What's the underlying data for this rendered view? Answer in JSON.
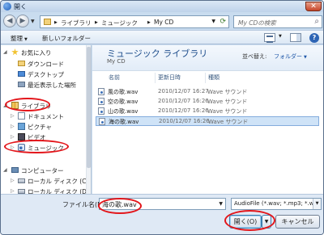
{
  "window": {
    "title": "開く",
    "close_label": "✕"
  },
  "nav": {
    "back_label": "◀",
    "forward_label": "▶",
    "breadcrumb": [
      "ライブラリ",
      "ミュージック",
      "My CD"
    ],
    "separator": "▶",
    "search_placeholder": "My CDの検索"
  },
  "toolbar": {
    "organize_label": "整理",
    "new_folder_label": "新しいフォルダー",
    "help_label": "?"
  },
  "navpane": {
    "items": [
      {
        "label": "お気に入り",
        "icon": "star-icon"
      },
      {
        "label": "ダウンロード",
        "icon": "folder-icon"
      },
      {
        "label": "デスクトップ",
        "icon": "desktop-icon"
      },
      {
        "label": "最近表示した場所",
        "icon": "recent-places-icon"
      },
      {
        "label": "ライブラリ",
        "icon": "library-icon"
      },
      {
        "label": "ドキュメント",
        "icon": "documents-icon"
      },
      {
        "label": "ピクチャ",
        "icon": "pictures-icon"
      },
      {
        "label": "ビデオ",
        "icon": "videos-icon"
      },
      {
        "label": "ミュージック",
        "icon": "music-icon"
      },
      {
        "label": "コンピューター",
        "icon": "computer-icon"
      },
      {
        "label": "ローカル ディスク (C:)",
        "icon": "disk-icon"
      },
      {
        "label": "ローカル ディスク (D:)",
        "icon": "disk-icon"
      }
    ]
  },
  "library": {
    "title": "ミュージック ライブラリ",
    "subtitle": "My CD",
    "arrange_label": "並べ替え:",
    "arrange_value": "フォルダー"
  },
  "columns": {
    "name": "名前",
    "date": "更新日時",
    "type": "種類"
  },
  "files": [
    {
      "name": "風の歌.wav",
      "date": "2010/12/07 16:27",
      "type": "Wave サウンド",
      "selected": false
    },
    {
      "name": "空の歌.wav",
      "date": "2010/12/07 16:26",
      "type": "Wave サウンド",
      "selected": false
    },
    {
      "name": "山の歌.wav",
      "date": "2010/12/07 16:26",
      "type": "Wave サウンド",
      "selected": false
    },
    {
      "name": "海の歌.wav",
      "date": "2010/12/07 16:26",
      "type": "Wave サウンド",
      "selected": true
    }
  ],
  "footer": {
    "filename_label": "ファイル名(N):",
    "filename_value": "海の歌.wav",
    "filetype_value": "AudioFile (*.wav; *.mp3; *.w",
    "open_label": "開く(O)",
    "cancel_label": "キャンセル"
  },
  "colors": {
    "annotation": "#e3161b",
    "title": "#1e4e8c",
    "selection": "#cfe3f7"
  }
}
